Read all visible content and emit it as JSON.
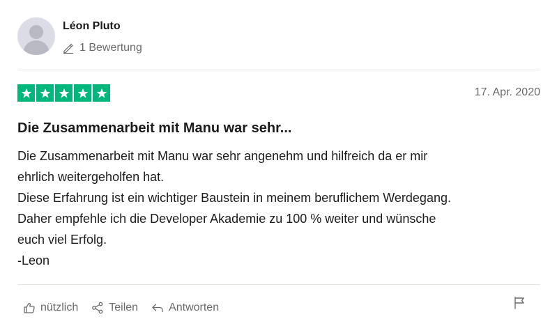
{
  "reviewer": {
    "name": "Léon Pluto",
    "review_count": "1 Bewertung",
    "avatar_icon": "user-silhouette-icon"
  },
  "review": {
    "rating": 5,
    "rating_max": 5,
    "date": "17. Apr. 2020",
    "title": "Die Zusammenarbeit mit Manu war sehr...",
    "lines": [
      "Die Zusammenarbeit mit Manu war sehr angenehm und hilfreich da er mir",
      "ehrlich weitergeholfen hat.",
      "Diese Erfahrung ist ein wichtiger Baustein in meinem beruflichem Werdegang.",
      "Daher empfehle ich die Developer Akademie zu 100 % weiter und wünsche",
      "euch viel Erfolg.",
      "-Leon"
    ]
  },
  "actions": {
    "useful_label": "nützlich",
    "share_label": "Teilen",
    "reply_label": "Antworten"
  },
  "colors": {
    "star_green": "#00b67a",
    "text_primary": "#1c1c1c",
    "text_secondary": "#6a6a6a",
    "divider": "#e5e5dd",
    "avatar_bg": "#dcdce6"
  }
}
